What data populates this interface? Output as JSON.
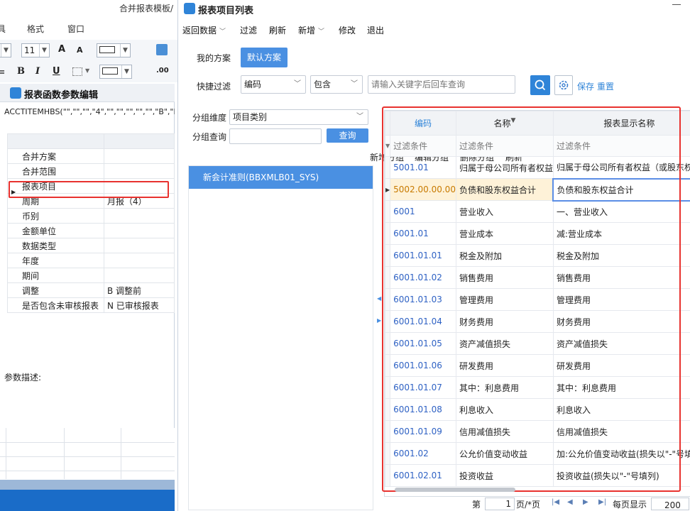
{
  "bg_app": {
    "title": "合并报表模板/",
    "menu": [
      "具",
      "格式",
      "窗口"
    ],
    "font_size": "11",
    "font_grow": "A",
    "font_shrink": "A",
    "bold": "B",
    "italic": "I",
    "underline": "U",
    "decimal": ".00"
  },
  "param_dialog": {
    "title": "报表函数参数编辑",
    "formula": "ACCTITEMHBS(\"\",\"\",\"\",\"4\",\"\",\"\",\"\",\"\",\"\",\"B\",\"N\")",
    "rows": [
      {
        "name": "合并方案",
        "value": ""
      },
      {
        "name": "合并范围",
        "value": ""
      },
      {
        "name": "报表项目",
        "value": ""
      },
      {
        "name": "周期",
        "value": "月报（4）"
      },
      {
        "name": "币别",
        "value": ""
      },
      {
        "name": "金额单位",
        "value": ""
      },
      {
        "name": "数据类型",
        "value": ""
      },
      {
        "name": "年度",
        "value": ""
      },
      {
        "name": "期间",
        "value": ""
      },
      {
        "name": "调整",
        "value": "B  调整前"
      },
      {
        "name": "是否包含未审核报表",
        "value": "N  已审核报表"
      }
    ],
    "desc_label": "参数描述:"
  },
  "window": {
    "title": "报表项目列表",
    "toolbar": {
      "back": "返回数据",
      "filter": "过滤",
      "refresh": "刷新",
      "add": "新增",
      "edit": "修改",
      "exit": "退出"
    },
    "plans": {
      "mine": "我的方案",
      "default": "默认方案"
    },
    "quick_filter": {
      "label": "快捷过滤",
      "field": "编码",
      "operator": "包含",
      "placeholder": "请输入关键字后回车查询",
      "save": "保存",
      "reset": "重置"
    },
    "group": {
      "dim_label": "分组维度",
      "dim_value": "项目类别",
      "query_label": "分组查询",
      "query_btn": "查询",
      "actions": [
        "新增分组",
        "编辑分组",
        "删除分组",
        "刷新"
      ],
      "items": [
        "新会计准则(BBXMLB01_SYS)"
      ]
    },
    "grid": {
      "headers": [
        "编码",
        "名称",
        "报表显示名称"
      ],
      "filter_text": "过滤条件",
      "rows": [
        {
          "code": "5001.01",
          "name": "归属于母公司所有者权益",
          "display": "归属于母公司所有者权益（或股东权益"
        },
        {
          "code": "5002.00.00.00",
          "name": "负债和股东权益合计",
          "display": "负债和股东权益合计"
        },
        {
          "code": "6001",
          "name": "营业收入",
          "display": "一、营业收入"
        },
        {
          "code": "6001.01",
          "name": "营业成本",
          "display": "减:营业成本"
        },
        {
          "code": "6001.01.01",
          "name": "税金及附加",
          "display": "税金及附加"
        },
        {
          "code": "6001.01.02",
          "name": "销售费用",
          "display": "销售费用"
        },
        {
          "code": "6001.01.03",
          "name": "管理费用",
          "display": "管理费用"
        },
        {
          "code": "6001.01.04",
          "name": "财务费用",
          "display": "财务费用"
        },
        {
          "code": "6001.01.05",
          "name": "资产减值损失",
          "display": "资产减值损失"
        },
        {
          "code": "6001.01.06",
          "name": "研发费用",
          "display": "研发费用"
        },
        {
          "code": "6001.01.07",
          "name": "其中：利息费用",
          "display": "其中：利息费用"
        },
        {
          "code": "6001.01.08",
          "name": "利息收入",
          "display": "利息收入"
        },
        {
          "code": "6001.01.09",
          "name": "信用减值损失",
          "display": "信用减值损失"
        },
        {
          "code": "6001.02",
          "name": "公允价值变动收益",
          "display": "加:公允价值变动收益(损失以\"-\"号填列)"
        },
        {
          "code": "6001.02.01",
          "name": "投资收益",
          "display": "投资收益(损失以\"-\"号填列)"
        }
      ]
    },
    "pager": {
      "page_prefix": "第",
      "page": "1",
      "page_suffix": "页/*页",
      "per_page_label": "每页显示",
      "per_page": "200"
    }
  },
  "colors": {
    "accent": "#4a90e2",
    "highlight_box": "#e8322f",
    "link": "#2f62c4"
  }
}
